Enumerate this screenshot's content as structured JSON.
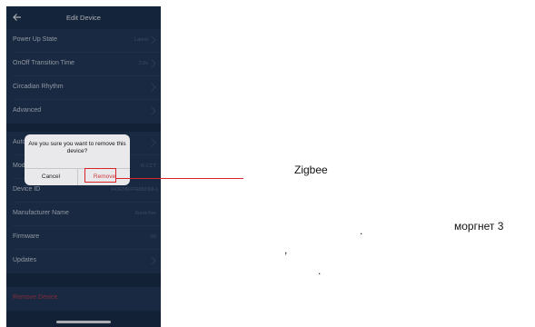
{
  "header": {
    "title": "Edit Device"
  },
  "rows": [
    {
      "label": "Power Up State",
      "value": "Latest"
    },
    {
      "label": "OnOff Transition Time",
      "value": "2.0s"
    },
    {
      "label": "Circadian Rhythm",
      "value": ""
    },
    {
      "label": "Advanced",
      "value": ""
    },
    {
      "label": "Autom",
      "value": ""
    },
    {
      "label": "Mode",
      "value": "R-CCT"
    },
    {
      "label": "Device ID",
      "value": "94DEB8FFFE858368-1"
    },
    {
      "label": "Manufacturer Name",
      "value": "Sunricher"
    },
    {
      "label": "Firmware",
      "value": "66"
    },
    {
      "label": "Updates",
      "value": ""
    }
  ],
  "remove_device": {
    "label": "Remove Device"
  },
  "dialog": {
    "message": "Are you sure you want to remove this device?",
    "cancel_label": "Cancel",
    "remove_label": "Remove"
  },
  "annotation": {
    "word1": "Zigbee",
    "dot1": ".",
    "text2": "моргнет 3",
    "comma": ",",
    "dot2": "."
  },
  "colors": {
    "panel": "#1b2f4b",
    "row": "#223757",
    "accent_red": "#d8242b"
  }
}
